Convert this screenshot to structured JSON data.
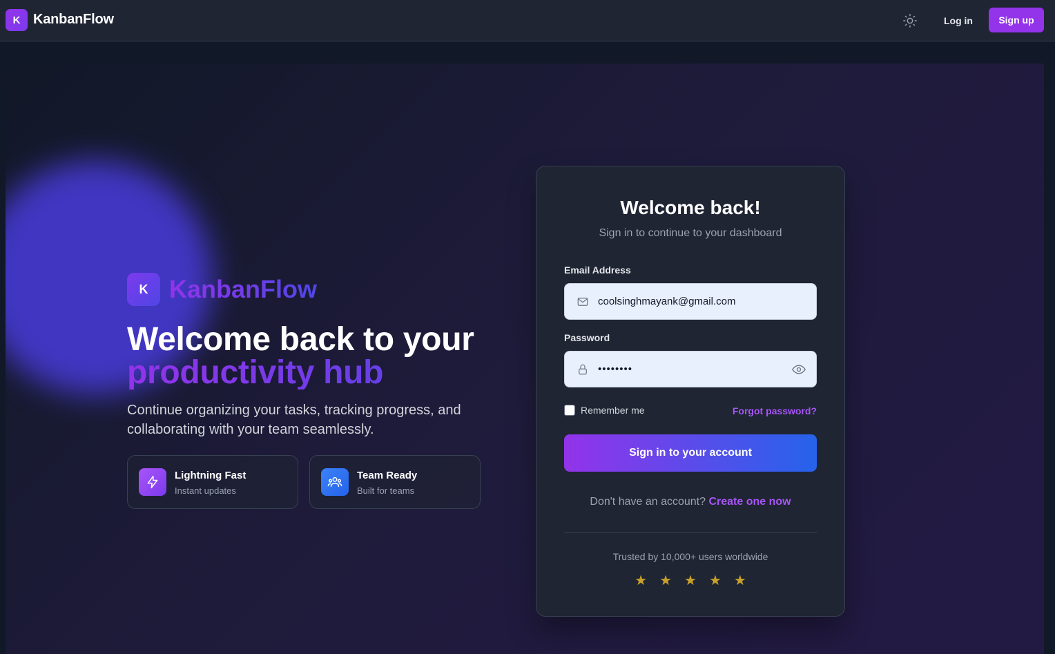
{
  "nav": {
    "logo_letter": "K",
    "brand": "KanbanFlow",
    "theme_icon": "sun-icon",
    "login_label": "Log in",
    "signup_label": "Sign up"
  },
  "hero": {
    "logo_letter": "K",
    "brand": "KanbanFlow",
    "headline_line1": "Welcome back to your",
    "headline_line2": "productivity hub",
    "subcopy": "Continue organizing your tasks, tracking progress, and collaborating with your team seamlessly.",
    "features": [
      {
        "icon": "lightning-icon",
        "title": "Lightning Fast",
        "subtitle": "Instant updates"
      },
      {
        "icon": "team-icon",
        "title": "Team Ready",
        "subtitle": "Built for teams"
      }
    ]
  },
  "login": {
    "title": "Welcome back!",
    "subtitle": "Sign in to continue to your dashboard",
    "email_label": "Email Address",
    "email_value": "coolsinghmayank@gmail.com",
    "password_label": "Password",
    "password_value": "••••••••",
    "remember_label": "Remember me",
    "forgot_label": "Forgot password?",
    "submit_label": "Sign in to your account",
    "no_account_text": "Don't have an account?",
    "create_label": "Create one now",
    "trusted_text": "Trusted by 10,000+ users worldwide",
    "rating_stars": 5
  },
  "colors": {
    "accent_purple": "#9333ea",
    "accent_blue": "#2563eb",
    "star_gold": "#c8a02a",
    "background": "#111827"
  }
}
